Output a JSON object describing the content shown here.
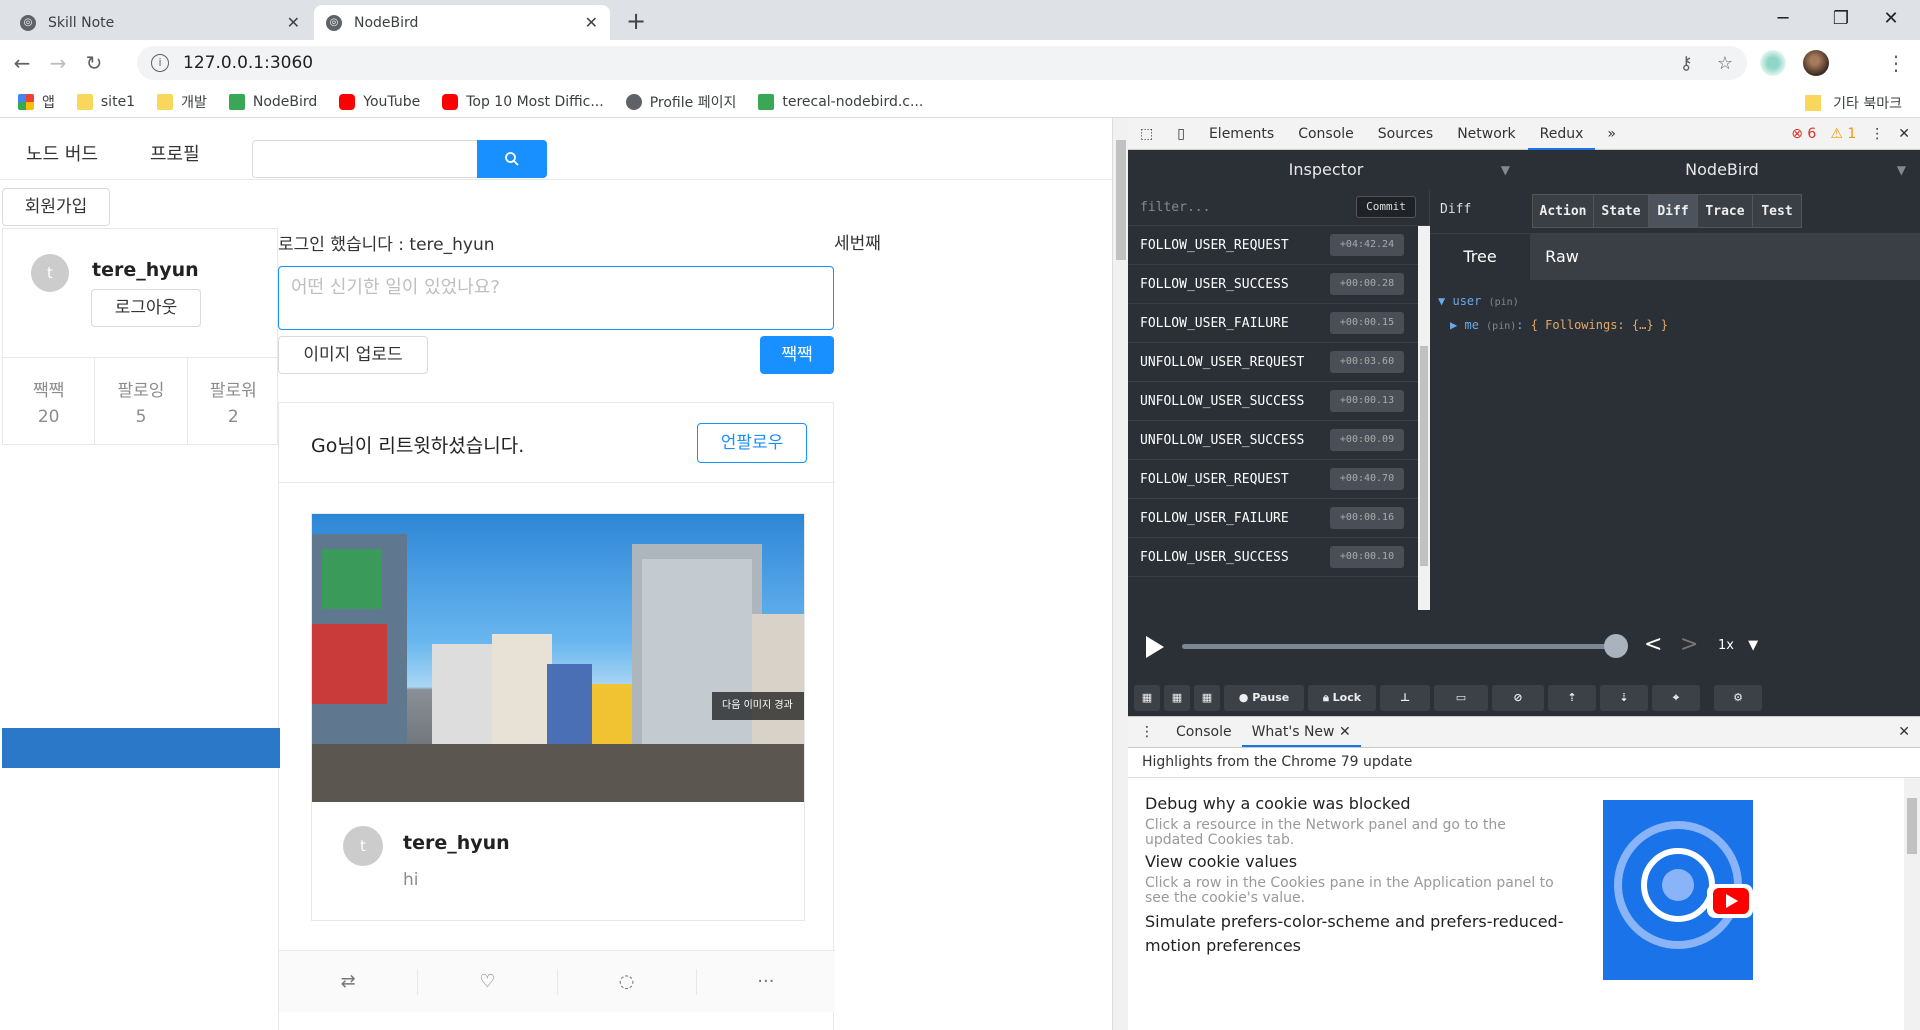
{
  "browser": {
    "tabs": [
      {
        "label": "Skill Note",
        "active": false
      },
      {
        "label": "NodeBird",
        "active": true
      }
    ],
    "address": "127.0.0.1:3060",
    "bookmarks": [
      "앱",
      "site1",
      "개발",
      "NodeBird",
      "YouTube",
      "Top 10 Most Diffic...",
      "Profile 페이지",
      "terecal-nodebird.c..."
    ],
    "bookmarks_other": "기타 북마크"
  },
  "app": {
    "nav": {
      "home": "노드 버드",
      "profile": "프로필"
    },
    "signup": "회원가입",
    "user": {
      "avatar_letter": "t",
      "name": "tere_hyun",
      "logout": "로그아웃",
      "stats": [
        {
          "label": "짹짹",
          "value": "20"
        },
        {
          "label": "팔로잉",
          "value": "5"
        },
        {
          "label": "팔로워",
          "value": "2"
        }
      ]
    },
    "login_message": "로그인 했습니다 : tere_hyun",
    "third_label": "세번째",
    "textarea_placeholder": "어떤 신기한 일이 있었나요?",
    "image_upload": "이미지 업로드",
    "tweet_button": "짹짹",
    "post": {
      "retweet_user": "Go",
      "retweet_message": "님이 리트윗하셨습니다.",
      "unfollow": "언팔로우",
      "image_overlay": "다음 이미지 경과",
      "author_letter": "t",
      "author": "tere_hyun",
      "content": "hi"
    }
  },
  "devtools": {
    "tabs": [
      "Elements",
      "Console",
      "Sources",
      "Network",
      "Redux"
    ],
    "active_tab": "Redux",
    "errors": "6",
    "warnings": "1",
    "redux": {
      "inspector": "Inspector",
      "instance": "NodeBird",
      "filter_placeholder": "filter...",
      "commit": "Commit",
      "actions": [
        {
          "name": "FOLLOW_USER_REQUEST",
          "time": "+04:42.24"
        },
        {
          "name": "FOLLOW_USER_SUCCESS",
          "time": "+00:00.28"
        },
        {
          "name": "FOLLOW_USER_FAILURE",
          "time": "+00:00.15"
        },
        {
          "name": "UNFOLLOW_USER_REQUEST",
          "time": "+00:03.60"
        },
        {
          "name": "UNFOLLOW_USER_SUCCESS",
          "time": "+00:00.13"
        },
        {
          "name": "UNFOLLOW_USER_SUCCESS",
          "time": "+00:00.09"
        },
        {
          "name": "FOLLOW_USER_REQUEST",
          "time": "+00:40.70"
        },
        {
          "name": "FOLLOW_USER_FAILURE",
          "time": "+00:00.16"
        },
        {
          "name": "FOLLOW_USER_SUCCESS",
          "time": "+00:00.10"
        }
      ],
      "diff_label": "Diff",
      "monitors": [
        "Action",
        "State",
        "Diff",
        "Trace",
        "Test"
      ],
      "active_monitor": "Diff",
      "views": [
        "Tree",
        "Raw"
      ],
      "tree": {
        "root": "user",
        "pin": "(pin)",
        "child": "me",
        "child_value": "{ Followings: {…} }"
      },
      "speed": "1x",
      "buttons": {
        "pause": "Pause",
        "lock": "Lock"
      }
    },
    "drawer": {
      "tabs": [
        "Console",
        "What's New"
      ],
      "subtitle": "Highlights from the Chrome 79 update",
      "items": [
        {
          "title": "Debug why a cookie was blocked",
          "desc": "Click a resource in the Network panel and go to the updated Cookies tab."
        },
        {
          "title": "View cookie values",
          "desc": "Click a row in the Cookies pane in the Application panel to see the cookie's value."
        },
        {
          "title": "Simulate prefers-color-scheme and prefers-reduced-motion preferences",
          "desc": ""
        }
      ]
    }
  }
}
